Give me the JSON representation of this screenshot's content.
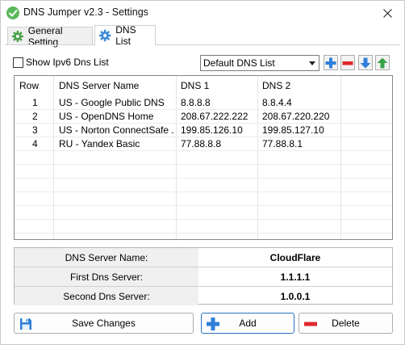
{
  "window": {
    "title": "DNS Jumper v2.3 - Settings"
  },
  "tabs": [
    {
      "label": "General Setting",
      "icon": "gear-icon",
      "active": false
    },
    {
      "label": "DNS List",
      "icon": "gear-icon",
      "active": true
    }
  ],
  "options": {
    "show_ipv6_label": "Show Ipv6 Dns List",
    "show_ipv6_checked": false
  },
  "list_select": {
    "selected": "Default DNS List"
  },
  "toolbar": {
    "add_icon": "plus-icon",
    "remove_icon": "minus-icon",
    "down_icon": "arrow-down-icon",
    "up_icon": "arrow-up-icon"
  },
  "table": {
    "columns": [
      "Row",
      "DNS Server Name",
      "DNS 1",
      "DNS 2"
    ],
    "rows": [
      {
        "row": "1",
        "name": "US - Google Public DNS",
        "dns1": "8.8.8.8",
        "dns2": "8.8.4.4"
      },
      {
        "row": "2",
        "name": "US - OpenDNS Home",
        "dns1": "208.67.222.222",
        "dns2": "208.67.220.220"
      },
      {
        "row": "3",
        "name": "US - Norton ConnectSafe ...",
        "dns1": "199.85.126.10",
        "dns2": "199.85.127.10"
      },
      {
        "row": "4",
        "name": "RU - Yandex Basic",
        "dns1": "77.88.8.8",
        "dns2": "77.88.8.1"
      }
    ]
  },
  "details": {
    "name_label": "DNS Server Name:",
    "name_value": "CloudFlare",
    "first_label": "First Dns Server:",
    "first_value": "1.1.1.1",
    "second_label": "Second Dns Server:",
    "second_value": "1.0.0.1"
  },
  "buttons": {
    "save": "Save Changes",
    "add": "Add",
    "delete": "Delete"
  },
  "colors": {
    "accent_blue": "#2a73c5",
    "add_blue": "#2f7fd8",
    "delete_red": "#e0282c",
    "up_green": "#3aa34a",
    "gear_green": "#46a046",
    "gear_blue": "#3c8ad6"
  }
}
